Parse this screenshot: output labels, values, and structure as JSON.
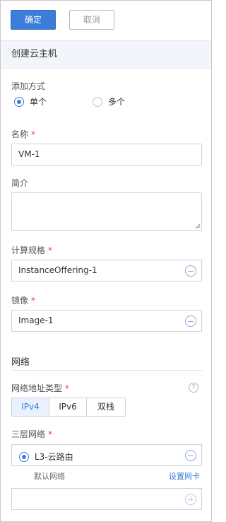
{
  "toolbar": {
    "confirm_label": "确定",
    "cancel_label": "取消"
  },
  "section_title": "创建云主机",
  "add_mode": {
    "label": "添加方式",
    "options": [
      "单个",
      "多个"
    ],
    "selected": "单个"
  },
  "name": {
    "label": "名称",
    "required_mark": "*",
    "value": "VM-1"
  },
  "description": {
    "label": "简介",
    "value": ""
  },
  "compute_offering": {
    "label": "计算规格",
    "required_mark": "*",
    "value": "InstanceOffering-1"
  },
  "image": {
    "label": "镜像",
    "required_mark": "*",
    "value": "Image-1"
  },
  "network": {
    "heading": "网络",
    "address_type_label": "网络地址类型",
    "address_type_required_mark": "*",
    "help_glyph": "?",
    "address_types": [
      "IPv4",
      "IPv6",
      "双栈"
    ],
    "address_type_selected": "IPv4",
    "l3_label": "三层网络",
    "l3_required_mark": "*",
    "l3_selected": "L3-云路由",
    "default_network_label": "默认网络",
    "set_nic_link": "设置网卡"
  },
  "colors": {
    "accent": "#3b7dd8",
    "required": "#e04b4b",
    "section_bg": "#f2f5f9"
  },
  "icons": {
    "remove": "minus-circle-icon",
    "add": "plus-circle-icon",
    "help": "question-circle-icon",
    "resize": "resize-grip-icon"
  }
}
